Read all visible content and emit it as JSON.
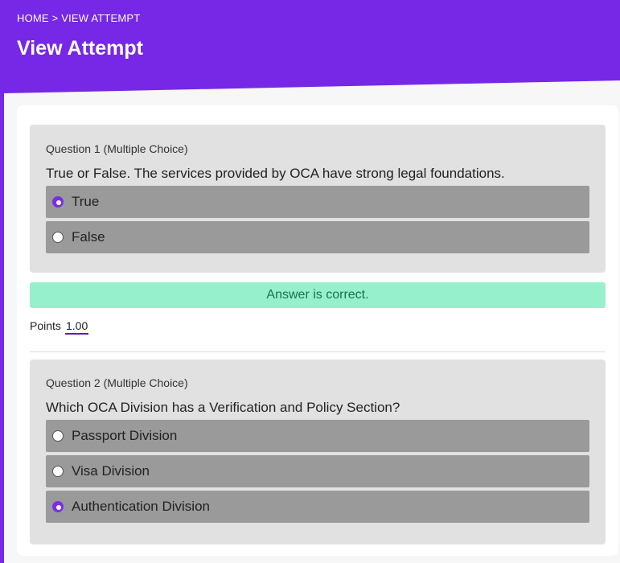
{
  "header": {
    "breadcrumb": "HOME > VIEW ATTEMPT",
    "title": "View Attempt"
  },
  "questions": [
    {
      "meta": "Question 1 (Multiple Choice)",
      "text": "True or False. The services provided by OCA have strong legal foundations.",
      "options": [
        {
          "label": "True",
          "selected": true
        },
        {
          "label": "False",
          "selected": false
        }
      ],
      "feedback": "Answer is correct.",
      "points_label": "Points",
      "points_value": "1.00"
    },
    {
      "meta": "Question 2 (Multiple Choice)",
      "text": "Which OCA Division has a Verification and Policy Section?",
      "options": [
        {
          "label": "Passport Division",
          "selected": false
        },
        {
          "label": "Visa Division",
          "selected": false
        },
        {
          "label": "Authentication Division",
          "selected": true
        }
      ]
    }
  ],
  "colors": {
    "accent": "#7628e6",
    "correct_bg": "#96f0cc",
    "correct_text": "#17734f",
    "option_bg": "#9a9a9a",
    "question_bg": "#e1e1e1"
  }
}
